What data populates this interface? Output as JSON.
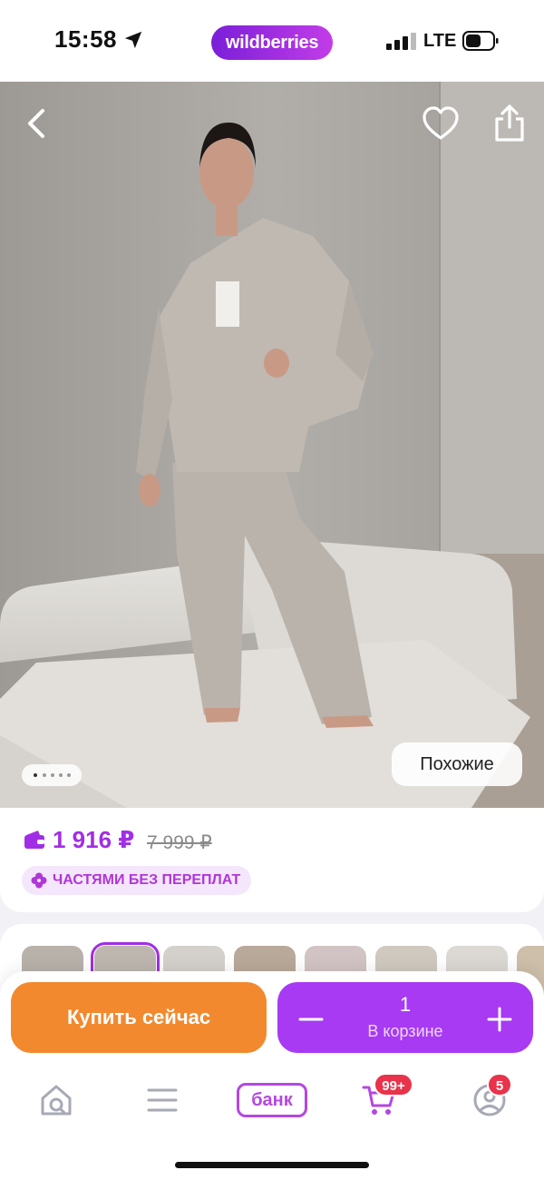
{
  "status_bar": {
    "time": "15:58",
    "network": "LTE"
  },
  "brand": "wildberries",
  "product": {
    "price": "1 916 ₽",
    "old_price": "7 999 ₽",
    "installment": "ЧАСТЯМИ БЕЗ ПЕРЕПЛАТ",
    "similar_label": "Похожие",
    "image_count": 5,
    "current_image": 1
  },
  "actions": {
    "buy_now": "Купить сейчас",
    "quantity": "1",
    "in_cart": "В корзине"
  },
  "tab_bar": {
    "bank_label": "банк",
    "cart_badge": "99+",
    "profile_badge": "5"
  },
  "colors": {
    "accent_purple": "#a73af2",
    "buy_orange": "#f2892e",
    "price_purple": "#a12ee6",
    "badge_red": "#e8334b"
  },
  "icons": [
    "location-arrow-icon",
    "signal-icon",
    "battery-icon",
    "back-icon",
    "heart-icon",
    "share-icon",
    "wallet-icon",
    "installment-icon",
    "minus-icon",
    "plus-icon",
    "home-search-icon",
    "menu-icon",
    "cart-icon",
    "profile-icon"
  ]
}
